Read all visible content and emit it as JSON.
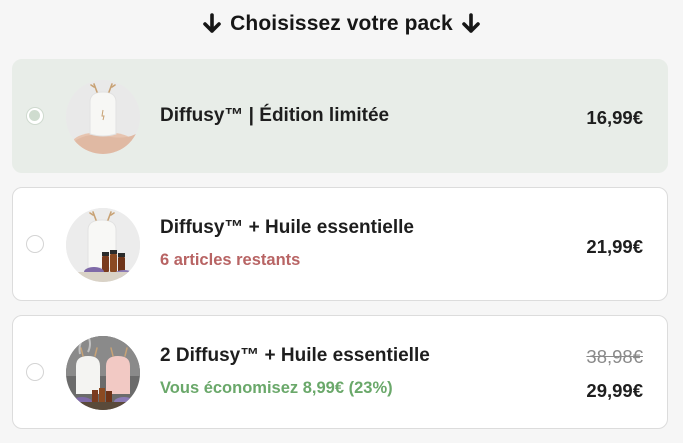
{
  "heading": {
    "text": "Choisissez votre pack",
    "left_icon": "arrow-down-icon",
    "right_icon": "arrow-down-icon"
  },
  "options": [
    {
      "title": "Diffusy™ | Édition limitée",
      "price": "16,99€",
      "selected": true,
      "image": "white-diffuser-on-hand"
    },
    {
      "title": "Diffusy™ + Huile essentielle",
      "subtitle": "6 articles restants",
      "price": "21,99€",
      "selected": false,
      "image": "white-diffuser-with-oil-bottles"
    },
    {
      "title": "2 Diffusy™ + Huile essentielle",
      "subtitle": "Vous économisez 8,99€ (23%)",
      "old_price": "38,98€",
      "price": "29,99€",
      "selected": false,
      "image": "two-diffusers-with-oil-bottles"
    }
  ],
  "colors": {
    "selected_background": "#e8ede8",
    "stock_text": "#b86464",
    "savings_text": "#6aa86a"
  }
}
